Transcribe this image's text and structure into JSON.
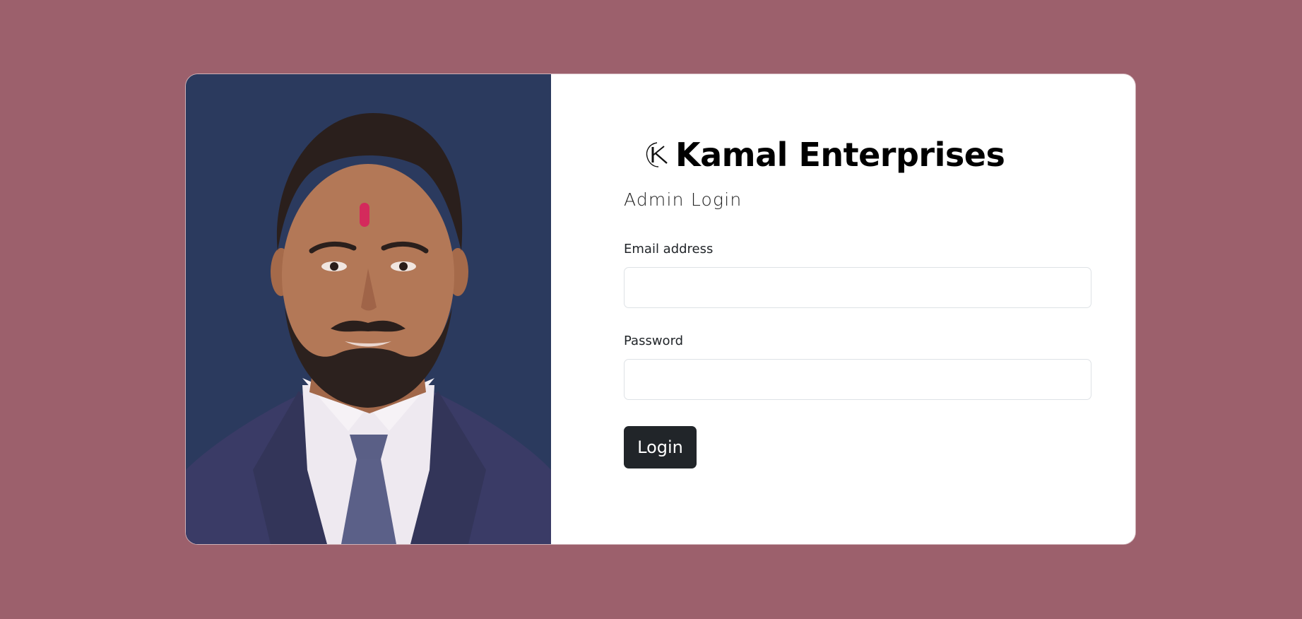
{
  "brand": {
    "name": "Kamal Enterprises",
    "logo_icon": "k-monogram-icon"
  },
  "login": {
    "subtitle": "Admin Login",
    "email_label": "Email address",
    "email_value": "",
    "email_placeholder": "",
    "password_label": "Password",
    "password_value": "",
    "password_placeholder": "",
    "button_label": "Login"
  },
  "photo": {
    "subject": "portrait-photo"
  },
  "colors": {
    "page_background": "#9c606c",
    "photo_background": "#2b3a5e",
    "button_background": "#212529",
    "tilak": "#d42a5c"
  }
}
